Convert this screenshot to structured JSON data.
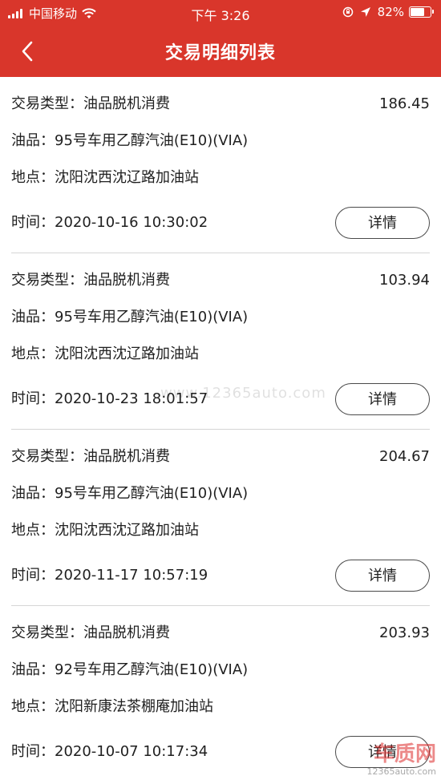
{
  "status_bar": {
    "carrier": "中国移动",
    "time": "下午 3:26",
    "battery_percent": "82%",
    "battery_level": 0.82
  },
  "nav": {
    "title": "交易明细列表",
    "back_icon": "chevron-left-icon"
  },
  "transactions": [
    {
      "type_label": "交易类型：",
      "type": "油品脱机消费",
      "amount": "186.45",
      "product_label": "油品：",
      "product": "95号车用乙醇汽油(E10)(VIA)",
      "location_label": "地点：",
      "location": "沈阳沈西沈辽路加油站",
      "time_label": "时间：",
      "time": "2020-10-16 10:30:02",
      "detail_button": "详情"
    },
    {
      "type_label": "交易类型：",
      "type": "油品脱机消费",
      "amount": "103.94",
      "product_label": "油品：",
      "product": "95号车用乙醇汽油(E10)(VIA)",
      "location_label": "地点：",
      "location": "沈阳沈西沈辽路加油站",
      "time_label": "时间：",
      "time": "2020-10-23 18:01:57",
      "detail_button": "详情"
    },
    {
      "type_label": "交易类型：",
      "type": "油品脱机消费",
      "amount": "204.67",
      "product_label": "油品：",
      "product": "95号车用乙醇汽油(E10)(VIA)",
      "location_label": "地点：",
      "location": "沈阳沈西沈辽路加油站",
      "time_label": "时间：",
      "time": "2020-11-17 10:57:19",
      "detail_button": "详情"
    },
    {
      "type_label": "交易类型：",
      "type": "油品脱机消费",
      "amount": "203.93",
      "product_label": "油品：",
      "product": "92号车用乙醇汽油(E10)(VIA)",
      "location_label": "地点：",
      "location": "沈阳新康法茶棚庵加油站",
      "time_label": "时间：",
      "time": "2020-10-07 10:17:34",
      "detail_button": "详情"
    }
  ],
  "watermark": {
    "text": "www.12365auto.com",
    "logo": "车质网",
    "url": "12365auto.com"
  },
  "colors": {
    "header": "#d9362b",
    "text": "#1f1f1f",
    "divider": "#d5d5d5"
  }
}
